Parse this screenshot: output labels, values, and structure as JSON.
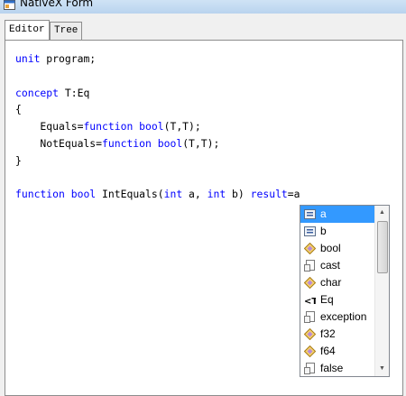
{
  "window": {
    "title": "NativeX Form"
  },
  "tabs": [
    {
      "label": "Editor",
      "active": true
    },
    {
      "label": "Tree",
      "active": false
    }
  ],
  "colors": {
    "keyword": "#0000ff",
    "selection": "#3399ff"
  },
  "code_lines": [
    [
      {
        "t": "unit",
        "k": 1
      },
      {
        "t": " program;"
      }
    ],
    [],
    [
      {
        "t": "concept",
        "k": 1
      },
      {
        "t": " T:Eq"
      }
    ],
    [
      {
        "t": "{"
      }
    ],
    [
      {
        "t": "    Equals="
      },
      {
        "t": "function",
        "k": 1
      },
      {
        "t": " "
      },
      {
        "t": "bool",
        "k": 1
      },
      {
        "t": "(T,T);"
      }
    ],
    [
      {
        "t": "    NotEquals="
      },
      {
        "t": "function",
        "k": 1
      },
      {
        "t": " "
      },
      {
        "t": "bool",
        "k": 1
      },
      {
        "t": "(T,T);"
      }
    ],
    [
      {
        "t": "}"
      }
    ],
    [],
    [
      {
        "t": "function",
        "k": 1
      },
      {
        "t": " "
      },
      {
        "t": "bool",
        "k": 1
      },
      {
        "t": " IntEquals("
      },
      {
        "t": "int",
        "k": 1
      },
      {
        "t": " a, "
      },
      {
        "t": "int",
        "k": 1
      },
      {
        "t": " b) "
      },
      {
        "t": "result",
        "k": 1
      },
      {
        "t": "=a"
      }
    ]
  ],
  "completion": {
    "items": [
      {
        "label": "a",
        "icon": "variable-icon",
        "selected": true
      },
      {
        "label": "b",
        "icon": "variable-icon"
      },
      {
        "label": "bool",
        "icon": "type-icon"
      },
      {
        "label": "cast",
        "icon": "keyword-icon"
      },
      {
        "label": "char",
        "icon": "type-icon"
      },
      {
        "label": "Eq",
        "icon": "concept-icon"
      },
      {
        "label": "exception",
        "icon": "keyword-icon"
      },
      {
        "label": "f32",
        "icon": "type-icon"
      },
      {
        "label": "f64",
        "icon": "type-icon"
      },
      {
        "label": "false",
        "icon": "keyword-icon"
      }
    ]
  }
}
